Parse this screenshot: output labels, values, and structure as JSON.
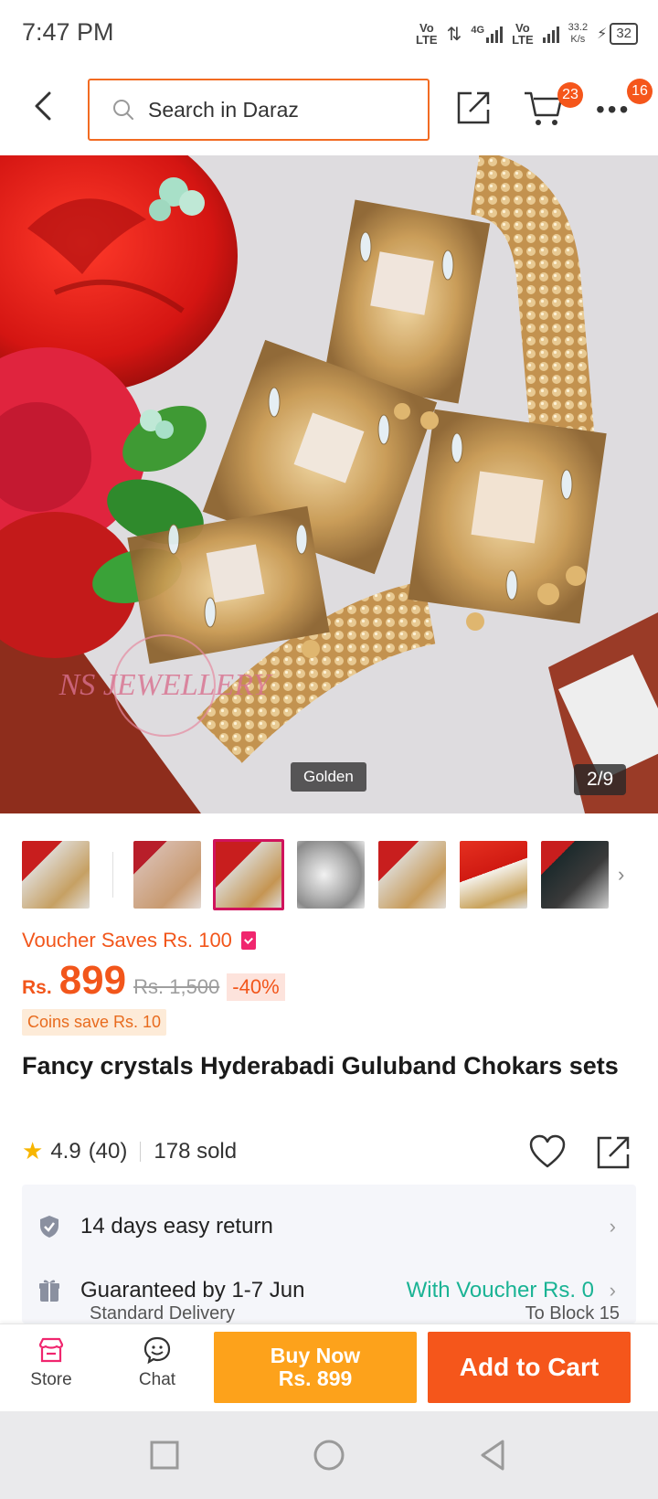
{
  "status_bar": {
    "time": "7:47 PM",
    "volte_1": "Vo LTE",
    "network_type": "4G",
    "volte_2": "Vo LTE",
    "net_speed_value": "33.2",
    "net_speed_unit": "K/s",
    "battery": "32"
  },
  "header": {
    "search_placeholder": "Search in Daraz",
    "cart_count": "23",
    "more_count": "16"
  },
  "gallery": {
    "variant_label": "Golden",
    "counter": "2/9",
    "watermark_text": "NS JEWELLERY",
    "thumbnails": [
      {
        "style": "jewel-red"
      },
      {
        "style": "jewel-pink"
      },
      {
        "style": "jewel-red",
        "active": true
      },
      {
        "style": "silver"
      },
      {
        "style": "jewel-red"
      },
      {
        "style": "red-set"
      },
      {
        "style": "black-set"
      }
    ]
  },
  "price_block": {
    "voucher_text": "Voucher Saves Rs. 100",
    "currency": "Rs.",
    "price": "899",
    "old_price": "Rs. 1,500",
    "discount": "-40%",
    "coins_text": "Coins save Rs. 10"
  },
  "product": {
    "title": "Fancy crystals Hyderabadi Guluband Chokars sets",
    "rating": "4.9",
    "review_count": "(40)",
    "sold": "178 sold"
  },
  "info": {
    "return_text": "14 days easy return",
    "delivery_text": "Guaranteed by 1-7 Jun",
    "voucher_text": "With Voucher Rs. 0",
    "delivery_type": "Standard Delivery",
    "delivery_location": "To Block 15"
  },
  "bottom_bar": {
    "store_label": "Store",
    "chat_label": "Chat",
    "buy_now_label": "Buy Now",
    "buy_now_price": "Rs. 899",
    "add_to_cart_label": "Add to Cart"
  },
  "colors": {
    "brand_orange": "#f5561b",
    "buy_now": "#fda21b",
    "voucher_green": "#1ab394",
    "voucher_pink": "#f0266e"
  }
}
